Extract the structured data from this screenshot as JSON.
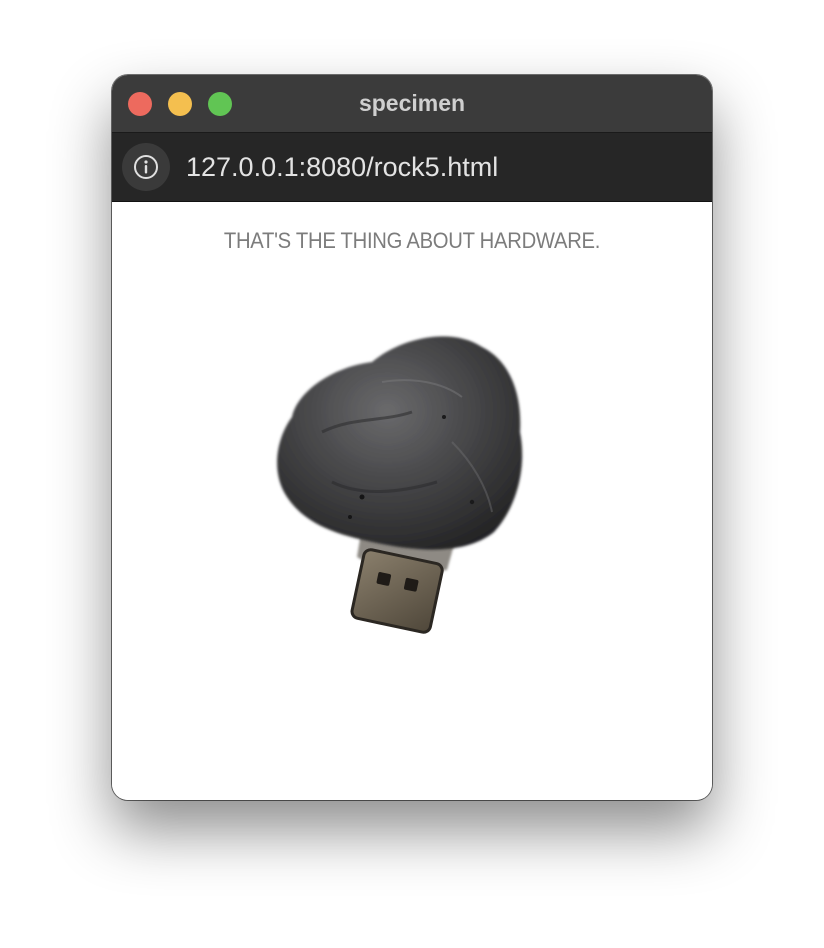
{
  "window": {
    "title": "specimen",
    "traffic_lights": {
      "close_color": "#ed6a5e",
      "minimize_color": "#f4bf4f",
      "maximize_color": "#61c554"
    }
  },
  "address_bar": {
    "icon": "info-icon",
    "url": "127.0.0.1:8080/rock5.html"
  },
  "page": {
    "caption": "THAT'S THE THING ABOUT HARDWARE.",
    "image": {
      "subject": "rock-with-usb-connector",
      "rock_color": "#3e3e40",
      "connector_color": "#6b6152"
    }
  }
}
